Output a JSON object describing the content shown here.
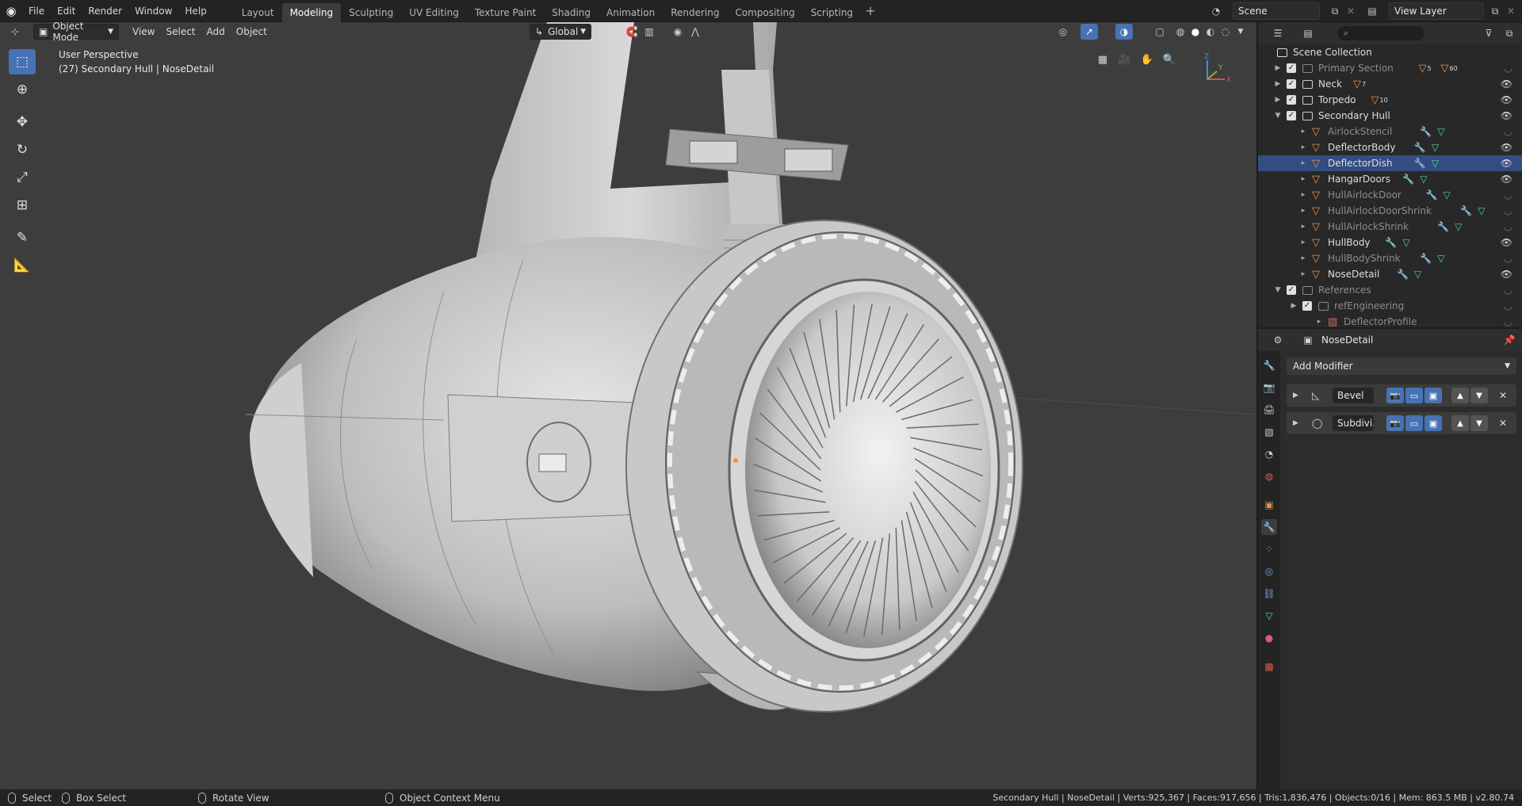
{
  "topbar": {
    "menus": [
      "File",
      "Edit",
      "Render",
      "Window",
      "Help"
    ],
    "workspaces": [
      "Layout",
      "Modeling",
      "Sculpting",
      "UV Editing",
      "Texture Paint",
      "Shading",
      "Animation",
      "Rendering",
      "Compositing",
      "Scripting"
    ],
    "active_workspace": "Modeling",
    "add_workspace": "+",
    "scene": "Scene",
    "view_layer": "View Layer"
  },
  "viewport": {
    "mode": "Object Mode",
    "menus": [
      "View",
      "Select",
      "Add",
      "Object"
    ],
    "orientation": "Global",
    "perspective_label": "User Perspective",
    "context_label": "(27) Secondary Hull | NoseDetail",
    "background_color": "#3d3d3d",
    "gizmo_axes": {
      "x": "X",
      "y": "Y",
      "z": "Z"
    }
  },
  "toolbar": {
    "tools": [
      "select-box",
      "cursor",
      "move",
      "rotate",
      "scale",
      "transform",
      "annotate",
      "measure"
    ],
    "active_tool": "select-box"
  },
  "outliner": {
    "scene_collection": "Scene Collection",
    "rows": [
      {
        "label": "Primary Section",
        "type": "collection",
        "checked": true,
        "dim": true,
        "counts": [
          "5",
          "60"
        ]
      },
      {
        "label": "Neck",
        "type": "collection",
        "checked": true,
        "dim": false,
        "counts": [
          "7"
        ]
      },
      {
        "label": "Torpedo",
        "type": "collection",
        "checked": true,
        "dim": false,
        "counts": [
          "10"
        ]
      },
      {
        "label": "Secondary Hull",
        "type": "collection",
        "checked": true,
        "dim": false,
        "expanded": true
      },
      {
        "label": "AirlockStencil",
        "type": "object",
        "dim": true
      },
      {
        "label": "DeflectorBody",
        "type": "object",
        "dim": false
      },
      {
        "label": "DeflectorDish",
        "type": "object",
        "dim": false,
        "selected": true
      },
      {
        "label": "HangarDoors",
        "type": "object",
        "dim": false
      },
      {
        "label": "HullAirlockDoor",
        "type": "object",
        "dim": true
      },
      {
        "label": "HullAirlockDoorShrink",
        "type": "object",
        "dim": true
      },
      {
        "label": "HullAirlockShrink",
        "type": "object",
        "dim": true
      },
      {
        "label": "HullBody",
        "type": "object",
        "dim": false
      },
      {
        "label": "HullBodyShrink",
        "type": "object",
        "dim": true
      },
      {
        "label": "NoseDetail",
        "type": "object",
        "dim": false
      },
      {
        "label": "References",
        "type": "collection",
        "checked": true,
        "dim": true,
        "expanded": true
      },
      {
        "label": "refEngineering",
        "type": "collection",
        "checked": true,
        "dim": true
      },
      {
        "label": "DeflectorProfile",
        "type": "image",
        "dim": true
      }
    ]
  },
  "properties": {
    "object_name": "NoseDetail",
    "add_modifier": "Add Modifier",
    "modifiers": [
      {
        "name": "Bevel"
      },
      {
        "name": "Subdivi..."
      }
    ]
  },
  "statusbar": {
    "select": "Select",
    "box_select": "Box Select",
    "rotate_view": "Rotate View",
    "context_menu": "Object Context Menu",
    "stats": "Secondary Hull | NoseDetail | Verts:925,367 | Faces:917,656 | Tris:1,836,476 | Objects:0/16 | Mem: 863.5 MB | v2.80.74"
  },
  "colors": {
    "accent": "#4772b3",
    "selection_row": "#334d80",
    "object_icon": "#e8914b",
    "mesh_icon": "#55d4a0",
    "modifier_icon": "#6ea0de"
  }
}
